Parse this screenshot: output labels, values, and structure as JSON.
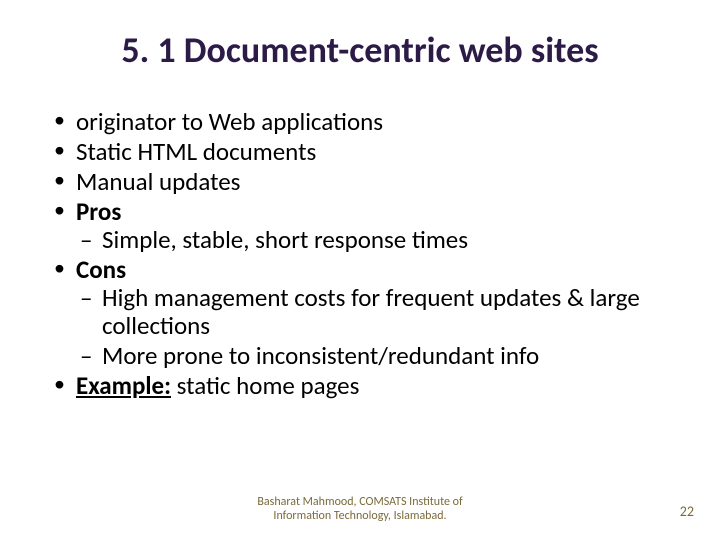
{
  "title": "5. 1 Document-centric web sites",
  "bullets": {
    "b1": "originator to Web applications",
    "b2": "Static HTML documents",
    "b3": "Manual updates",
    "b4": "Pros",
    "b4_s1": "Simple, stable, short response times",
    "b5": "Cons",
    "b5_s1": "High management costs for frequent updates & large collections",
    "b5_s2": "More prone to inconsistent/redundant info",
    "b6_label": "Example:",
    "b6_text": " static home pages"
  },
  "footer": {
    "line1": "Basharat Mahmood, COMSATS Institute of",
    "line2": "Information Technology, Islamabad."
  },
  "page_number": "22"
}
